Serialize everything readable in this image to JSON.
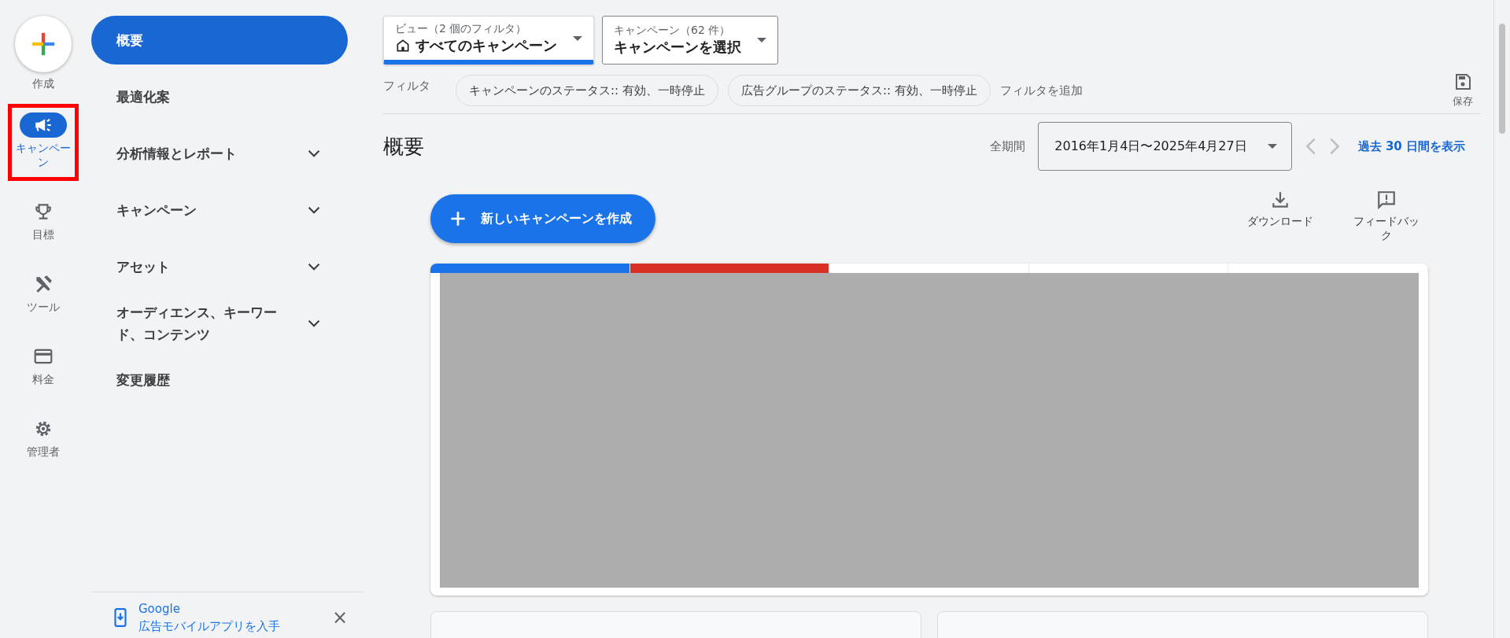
{
  "rail": {
    "create": {
      "label": "作成"
    },
    "items": [
      {
        "label": "キャンペーン",
        "kind": "megaphone",
        "selected": true,
        "highlighted": true
      },
      {
        "label": "目標",
        "kind": "trophy",
        "selected": false,
        "highlighted": false
      },
      {
        "label": "ツール",
        "kind": "tools",
        "selected": false,
        "highlighted": false
      },
      {
        "label": "料金",
        "kind": "card",
        "selected": false,
        "highlighted": false
      },
      {
        "label": "管理者",
        "kind": "gear",
        "selected": false,
        "highlighted": false
      }
    ]
  },
  "sidebar": {
    "items": [
      {
        "label": "概要",
        "selected": true,
        "expandable": false
      },
      {
        "label": "最適化案",
        "selected": false,
        "expandable": false
      },
      {
        "label": "分析情報とレポート",
        "selected": false,
        "expandable": true
      },
      {
        "label": "キャンペーン",
        "selected": false,
        "expandable": true
      },
      {
        "label": "アセット",
        "selected": false,
        "expandable": true
      },
      {
        "label": "オーディエンス、キーワード、コンテンツ",
        "selected": false,
        "expandable": true
      },
      {
        "label": "変更履歴",
        "selected": false,
        "expandable": false
      }
    ],
    "promo": {
      "line1": "Google",
      "line2": "広告モバイルアプリを入手",
      "close": "×"
    }
  },
  "selectors": [
    {
      "caption": "ビュー（2 個のフィルタ）",
      "value": "すべてのキャンペーン",
      "home_icon": true,
      "selected": true
    },
    {
      "caption": "キャンペーン（62 件）",
      "value": "キャンペーンを選択",
      "home_icon": false,
      "selected": false
    }
  ],
  "filters": {
    "label": "フィルタ",
    "chips": [
      "キャンペーンのステータス:: 有効、一時停止",
      "広告グループのステータス:: 有効、一時停止"
    ],
    "add": "フィルタを追加",
    "save": "保存"
  },
  "header": {
    "title": "概要",
    "period_label": "全期間",
    "date_range": "2016年1月4日〜2025年4月27日",
    "link": "過去 30 日間を表示"
  },
  "actions": {
    "new_campaign": "新しいキャンペーンを作成",
    "download": "ダウンロード",
    "feedback": "フィードバック"
  },
  "metric_tiles": [
    {
      "color": "#1a73e8"
    },
    {
      "color": "#d93025"
    },
    {
      "color": "#ffffff"
    },
    {
      "color": "#ffffff"
    },
    {
      "color": "#ffffff"
    }
  ]
}
